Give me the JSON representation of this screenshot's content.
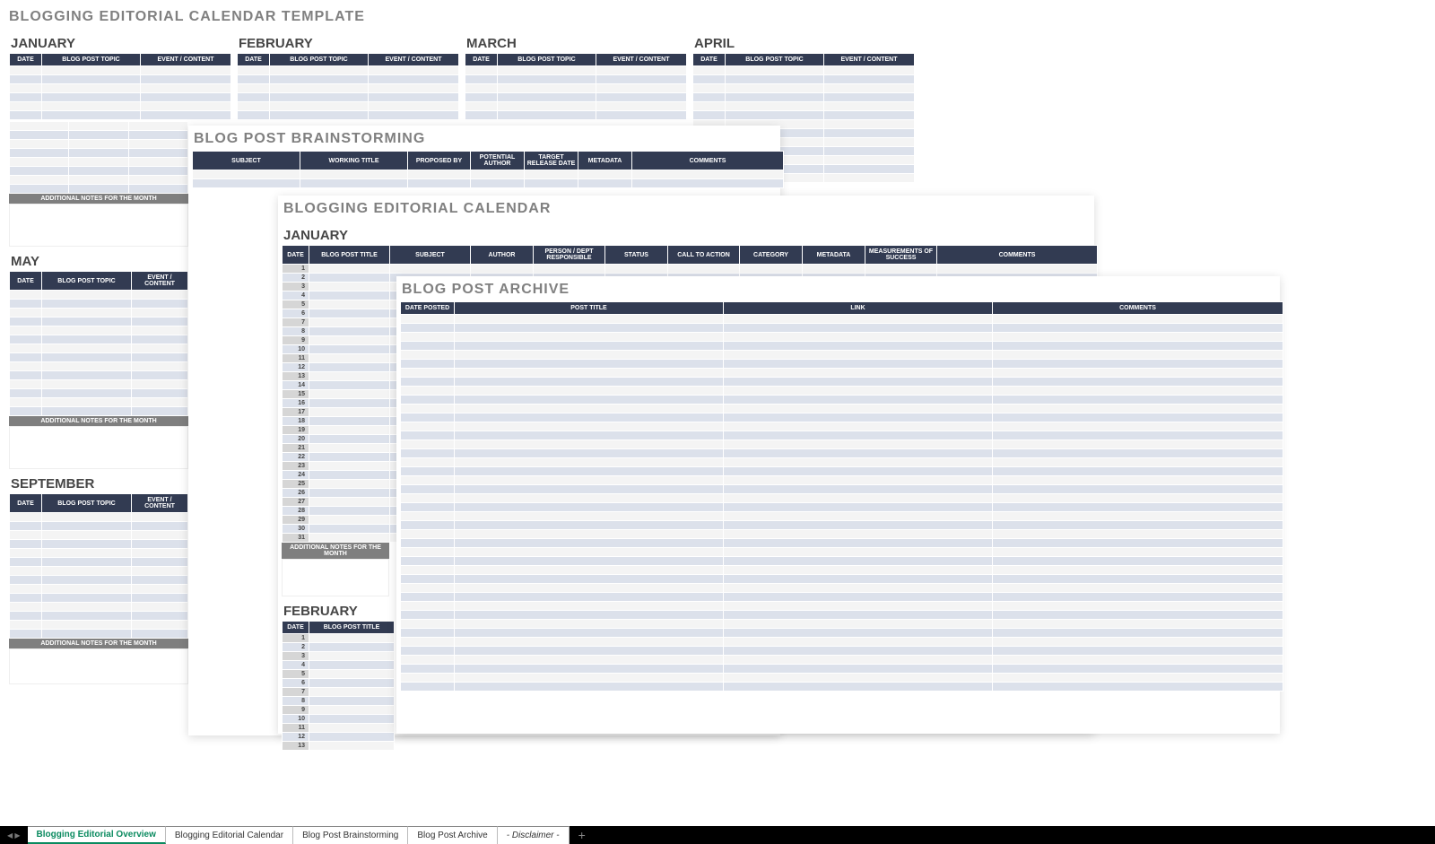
{
  "template": {
    "title": "BLOGGING EDITORIAL CALENDAR TEMPLATE",
    "months_row1": [
      "JANUARY",
      "FEBRUARY",
      "MARCH",
      "APRIL"
    ],
    "months_left": [
      "MAY",
      "SEPTEMBER"
    ],
    "headers3": [
      "DATE",
      "BLOG POST TOPIC",
      "EVENT / CONTENT"
    ],
    "notes_label": "ADDITIONAL NOTES FOR THE MONTH"
  },
  "brainstorm": {
    "title": "BLOG POST BRAINSTORMING",
    "headers": [
      "SUBJECT",
      "WORKING TITLE",
      "PROPOSED BY",
      "POTENTIAL AUTHOR",
      "TARGET RELEASE DATE",
      "METADATA",
      "COMMENTS"
    ]
  },
  "calendar": {
    "title": "BLOGGING EDITORIAL CALENDAR",
    "month1": "JANUARY",
    "month2": "FEBRUARY",
    "headers": [
      "DATE",
      "BLOG POST TITLE",
      "SUBJECT",
      "AUTHOR",
      "PERSON / DEPT RESPONSIBLE",
      "STATUS",
      "CALL TO ACTION",
      "CATEGORY",
      "METADATA",
      "MEASUREMENTS OF SUCCESS",
      "COMMENTS"
    ],
    "notes_label": "ADDITIONAL NOTES FOR THE MONTH",
    "days_jan": [
      1,
      2,
      3,
      4,
      5,
      6,
      7,
      8,
      9,
      10,
      11,
      12,
      13,
      14,
      15,
      16,
      17,
      18,
      19,
      20,
      21,
      22,
      23,
      24,
      25,
      26,
      27,
      28,
      29,
      30,
      31
    ],
    "days_feb": [
      1,
      2,
      3,
      4,
      5,
      6,
      7,
      8,
      9,
      10,
      11,
      12,
      13
    ]
  },
  "archive": {
    "title": "BLOG POST ARCHIVE",
    "headers": [
      "DATE POSTED",
      "POST TITLE",
      "LINK",
      "COMMENTS"
    ]
  },
  "tabs": {
    "t1": "Blogging Editorial Overview",
    "t2": "Blogging Editorial Calendar",
    "t3": "Blog Post Brainstorming",
    "t4": "Blog Post Archive",
    "t5": "- Disclaimer -"
  }
}
